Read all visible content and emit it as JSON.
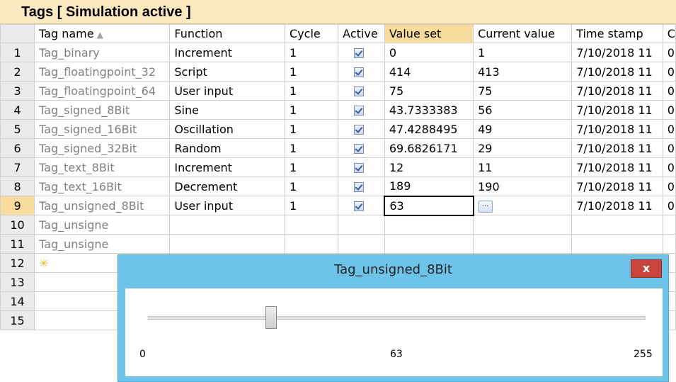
{
  "window": {
    "title": "Tags [ Simulation active ]"
  },
  "columns": [
    "Tag name",
    "Function",
    "Cycle",
    "Active",
    "Value set",
    "Current value",
    "Time stamp",
    "C"
  ],
  "rows": [
    {
      "num": "1",
      "tag": "Tag_binary",
      "func": "Increment",
      "cycle": "1",
      "active": true,
      "value_set": "0",
      "current": "1",
      "time": "7/10/2018 11",
      "extra": "0"
    },
    {
      "num": "2",
      "tag": "Tag_floatingpoint_32",
      "func": "Script",
      "cycle": "1",
      "active": true,
      "value_set": "414",
      "current": "413",
      "time": "7/10/2018 11",
      "extra": "0"
    },
    {
      "num": "3",
      "tag": "Tag_floatingpoint_64",
      "func": "User input",
      "cycle": "1",
      "active": true,
      "value_set": "75",
      "current": "75",
      "time": "7/10/2018 11",
      "extra": "0"
    },
    {
      "num": "4",
      "tag": "Tag_signed_8Bit",
      "func": "Sine",
      "cycle": "1",
      "active": true,
      "value_set": "43.7333383",
      "current": "56",
      "time": "7/10/2018 11",
      "extra": "0"
    },
    {
      "num": "5",
      "tag": "Tag_signed_16Bit",
      "func": "Oscillation",
      "cycle": "1",
      "active": true,
      "value_set": "47.4288495",
      "current": "49",
      "time": "7/10/2018 11",
      "extra": "0"
    },
    {
      "num": "6",
      "tag": "Tag_signed_32Bit",
      "func": "Random",
      "cycle": "1",
      "active": true,
      "value_set": "69.6826171",
      "current": "29",
      "time": "7/10/2018 11",
      "extra": "0"
    },
    {
      "num": "7",
      "tag": "Tag_text_8Bit",
      "func": "Increment",
      "cycle": "1",
      "active": true,
      "value_set": "12",
      "current": "11",
      "time": "7/10/2018 11",
      "extra": "0"
    },
    {
      "num": "8",
      "tag": "Tag_text_16Bit",
      "func": "Decrement",
      "cycle": "1",
      "active": true,
      "value_set": "189",
      "current": "190",
      "time": "7/10/2018 11",
      "extra": "0"
    },
    {
      "num": "9",
      "tag": "Tag_unsigned_8Bit",
      "func": "User input",
      "cycle": "1",
      "active": true,
      "value_set": "63",
      "current": "",
      "time": "7/10/2018 11",
      "extra": "0"
    },
    {
      "num": "10",
      "tag": "Tag_unsigne",
      "func": "",
      "cycle": "",
      "active": false,
      "value_set": "",
      "current": "",
      "time": "",
      "extra": ""
    },
    {
      "num": "11",
      "tag": "Tag_unsigne",
      "func": "",
      "cycle": "",
      "active": false,
      "value_set": "",
      "current": "",
      "time": "",
      "extra": ""
    },
    {
      "num": "12",
      "tag": "",
      "func": "",
      "cycle": "",
      "active": false,
      "value_set": "",
      "current": "",
      "time": "",
      "extra": ""
    },
    {
      "num": "13",
      "tag": "",
      "func": "",
      "cycle": "",
      "active": false,
      "value_set": "",
      "current": "",
      "time": "",
      "extra": ""
    },
    {
      "num": "14",
      "tag": "",
      "func": "",
      "cycle": "",
      "active": false,
      "value_set": "",
      "current": "",
      "time": "",
      "extra": ""
    },
    {
      "num": "15",
      "tag": "",
      "func": "",
      "cycle": "",
      "active": false,
      "value_set": "",
      "current": "",
      "time": "",
      "extra": ""
    }
  ],
  "editing_row": 9,
  "editor_button": "...",
  "popup": {
    "title": "Tag_unsigned_8Bit",
    "close": "x",
    "slider": {
      "min": "0",
      "max": "255",
      "value": "63",
      "fraction": 0.247
    }
  },
  "colors": {
    "header_bg": "#fce9c2",
    "highlight": "#f8dc9e",
    "popup_frame": "#6ec3e8",
    "close_button": "#c8453c"
  },
  "icons": {
    "sort": "sort-ascending-icon",
    "new_row": "new-row-icon",
    "checkbox": "checkbox-checked-icon"
  }
}
